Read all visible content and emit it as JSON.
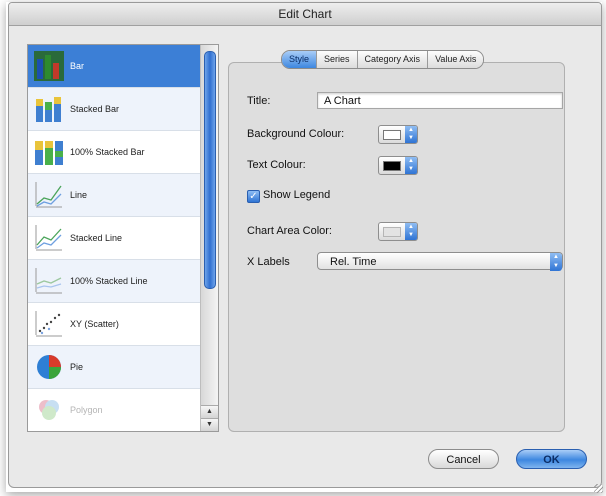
{
  "window": {
    "title": "Edit Chart"
  },
  "chart_types": [
    {
      "label": "Bar",
      "icon": "bar-chart-icon",
      "selected": true
    },
    {
      "label": "Stacked Bar",
      "icon": "stacked-bar-icon"
    },
    {
      "label": "100% Stacked Bar",
      "icon": "percent-stacked-bar-icon"
    },
    {
      "label": "Line",
      "icon": "line-chart-icon"
    },
    {
      "label": "Stacked Line",
      "icon": "stacked-line-icon"
    },
    {
      "label": "100% Stacked Line",
      "icon": "percent-stacked-line-icon"
    },
    {
      "label": "XY (Scatter)",
      "icon": "scatter-chart-icon"
    },
    {
      "label": "Pie",
      "icon": "pie-chart-icon"
    },
    {
      "label": "Polygon",
      "icon": "polygon-chart-icon",
      "disabled": true
    }
  ],
  "tabs": [
    {
      "label": "Style",
      "active": true
    },
    {
      "label": "Series"
    },
    {
      "label": "Category Axis"
    },
    {
      "label": "Value Axis"
    }
  ],
  "form": {
    "title_label": "Title:",
    "title_value": "A Chart",
    "background_label": "Background Colour:",
    "background_color": "#ffffff",
    "text_colour_label": "Text Colour:",
    "text_color": "#000000",
    "show_legend_label": "Show Legend",
    "show_legend_checked": true,
    "chart_area_label": "Chart Area Color:",
    "chart_area_color": "#e3e3e3",
    "x_labels_label": "X Labels",
    "x_labels_value": "Rel. Time"
  },
  "buttons": {
    "cancel": "Cancel",
    "ok": "OK"
  },
  "colors": {
    "accent": "#3c7fd6",
    "window_bg": "#e9e9e9"
  }
}
